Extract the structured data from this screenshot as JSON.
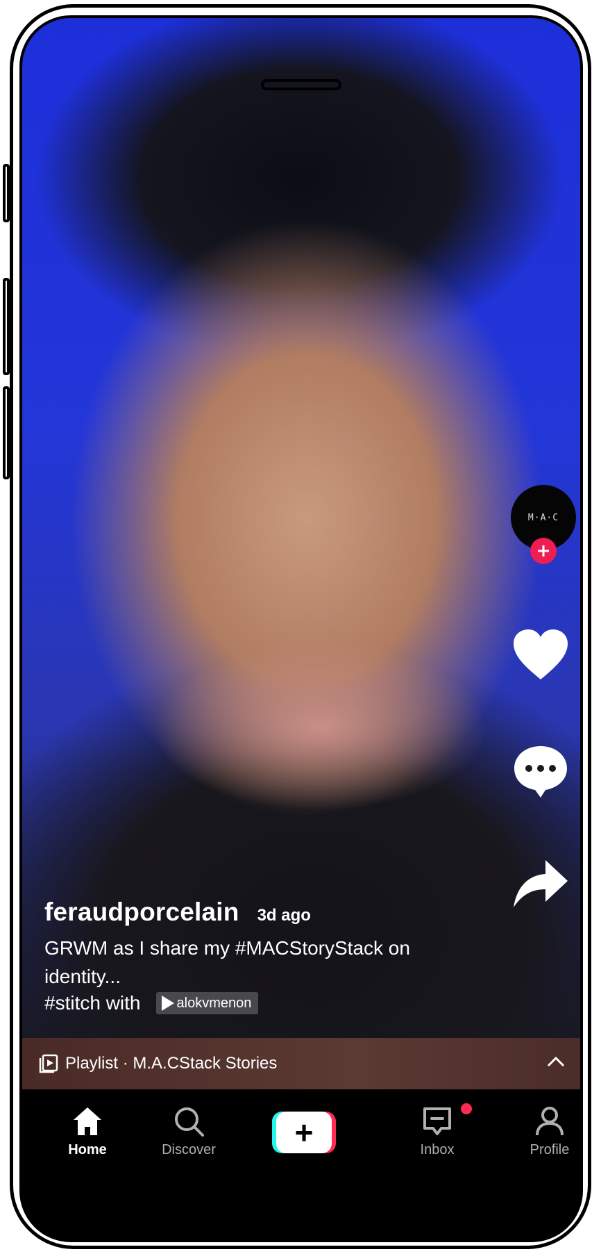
{
  "video": {
    "username": "feraudporcelain",
    "timestamp": "3d ago",
    "description": "GRWM as I share my #MACStoryStack on identity...",
    "stitch_label": "#stitch with",
    "stitch_user": "alokvmenon",
    "avatar_logo": "M·A·C"
  },
  "actions": {
    "like_icon": "heart-icon",
    "comment_icon": "comment-icon",
    "share_icon": "share-icon"
  },
  "playlist": {
    "label": "Playlist · M.A.CStack Stories"
  },
  "nav": {
    "items": [
      {
        "label": "Home",
        "icon": "home-icon",
        "active": true
      },
      {
        "label": "Discover",
        "icon": "search-icon",
        "active": false
      },
      {
        "label": "",
        "icon": "plus-icon",
        "active": false
      },
      {
        "label": "Inbox",
        "icon": "inbox-icon",
        "active": false
      },
      {
        "label": "Profile",
        "icon": "profile-icon",
        "active": false
      }
    ],
    "create_symbol": "+"
  },
  "colors": {
    "accent_red": "#fe2c55",
    "accent_cyan": "#25f4ee",
    "follow_red": "#ee1d52",
    "video_blue": "#2336d8"
  }
}
